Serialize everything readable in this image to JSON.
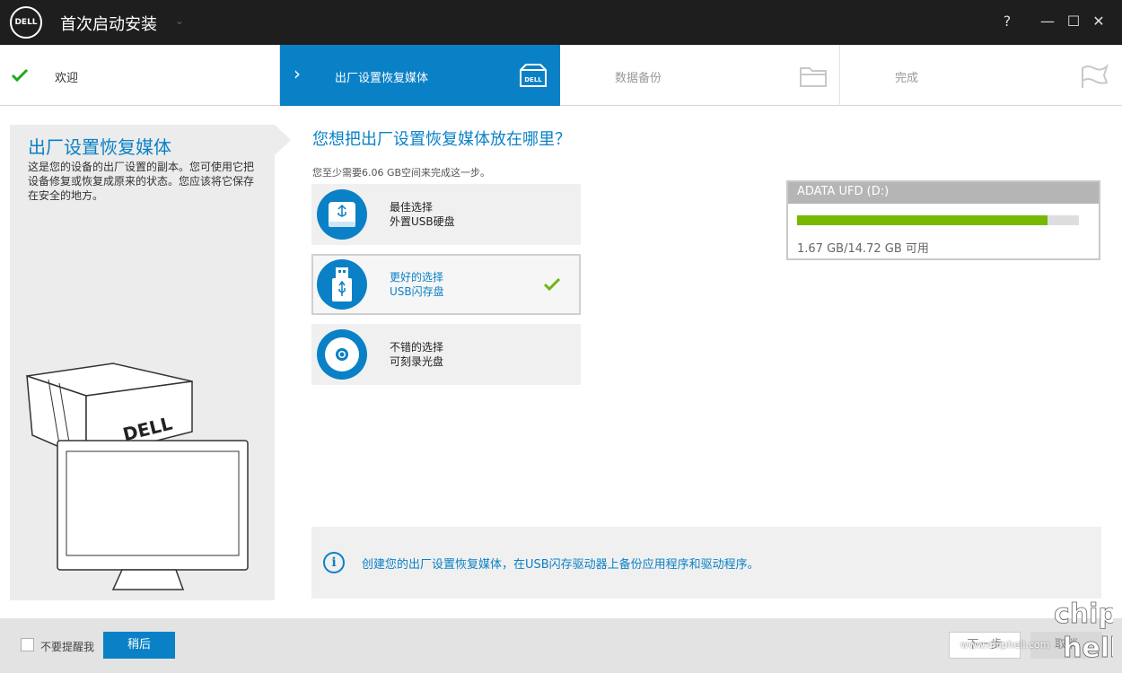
{
  "titlebar": {
    "logo_text": "DELL",
    "title": "首次启动安装",
    "help": "?",
    "minimize": "—",
    "maximize": "☐",
    "close": "✕"
  },
  "steps": [
    {
      "label": "欢迎",
      "state": "done"
    },
    {
      "label": "出厂设置恢复媒体",
      "state": "active"
    },
    {
      "label": "数据备份",
      "state": "pending"
    },
    {
      "label": "完成",
      "state": "pending"
    }
  ],
  "left_panel": {
    "title": "出厂设置恢复媒体",
    "description": "这是您的设备的出厂设置的副本。您可使用它把设备修复或恢复成原来的状态。您应该将它保存在安全的地方。",
    "box_logo": "DELL"
  },
  "main": {
    "question": "您想把出厂设置恢复媒体放在哪里？",
    "requirement": "您至少需要6.06 GB空间来完成这一步。",
    "options": [
      {
        "line1": "最佳选择",
        "line2": "外置USB硬盘",
        "icon": "usb-hard-drive-icon",
        "selected": false
      },
      {
        "line1": "更好的选择",
        "line2": "USB闪存盘",
        "icon": "usb-flash-drive-icon",
        "selected": true
      },
      {
        "line1": "不错的选择",
        "line2": "可刻录光盘",
        "icon": "optical-disc-icon",
        "selected": false
      }
    ]
  },
  "drive": {
    "name": "ADATA UFD (D:)",
    "usage_fraction": 0.887,
    "size_text": "1.67 GB/14.72 GB 可用"
  },
  "info": {
    "text": "创建您的出厂设置恢复媒体，在USB闪存驱动器上备份应用程序和驱动程序。"
  },
  "footer": {
    "dont_remind": "不要提醒我",
    "later": "稍后",
    "next": "下一步",
    "cancel": "取消"
  },
  "watermark": {
    "url": "www.chiphell.com",
    "logo": "chip hell"
  },
  "colors": {
    "accent": "#0a81c6",
    "check": "#6fb513",
    "bar": "#76b900",
    "titlebar": "#1e1e1e"
  }
}
